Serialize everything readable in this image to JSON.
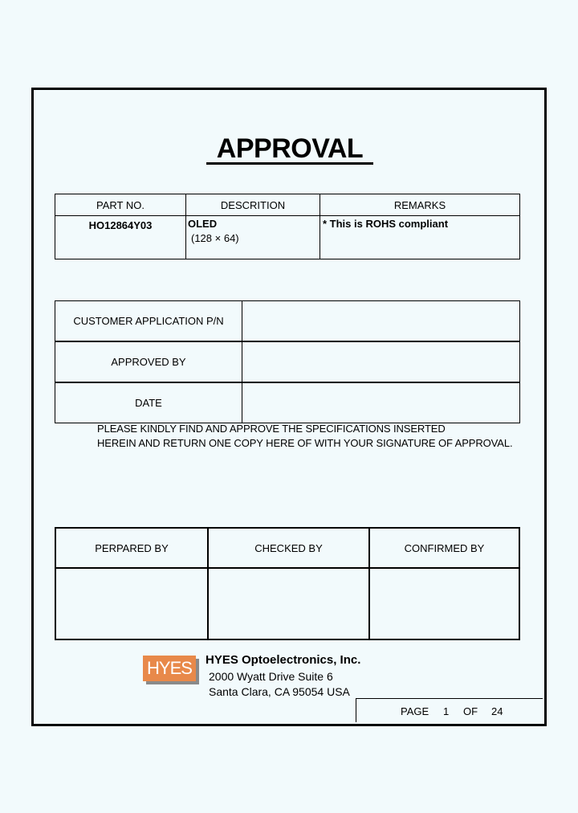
{
  "document": {
    "title": "APPROVAL"
  },
  "part_table": {
    "headers": [
      "PART NO.",
      "DESCRITION",
      "REMARKS"
    ],
    "part_no": "HO12864Y03",
    "description_line1": "OLED",
    "description_line2": "(128 × 64)",
    "remarks": "* This is ROHS compliant"
  },
  "customer_table": {
    "rows": [
      {
        "label": "CUSTOMER APPLICATION P/N",
        "value": ""
      },
      {
        "label": "APPROVED BY",
        "value": ""
      },
      {
        "label": "DATE",
        "value": ""
      }
    ]
  },
  "note": {
    "line1": "PLEASE KINDLY FIND AND APPROVE THE SPECIFICATIONS INSERTED",
    "line2": "HEREIN AND RETURN ONE COPY HERE OF WITH YOUR SIGNATURE OF APPROVAL."
  },
  "signature_table": {
    "headers": [
      "PERPARED BY",
      "CHECKED BY",
      "CONFIRMED BY"
    ]
  },
  "company": {
    "logo_text": "HYES",
    "logo_color": "#e8894a",
    "name": "HYES Optoelectronics, Inc.",
    "address_line1": "2000 Wyatt Drive Suite 6",
    "address_line2": "Santa Clara, CA 95054 USA"
  },
  "pagination": {
    "page_label": "PAGE",
    "current": "1",
    "of_label": "OF",
    "total": "24"
  }
}
